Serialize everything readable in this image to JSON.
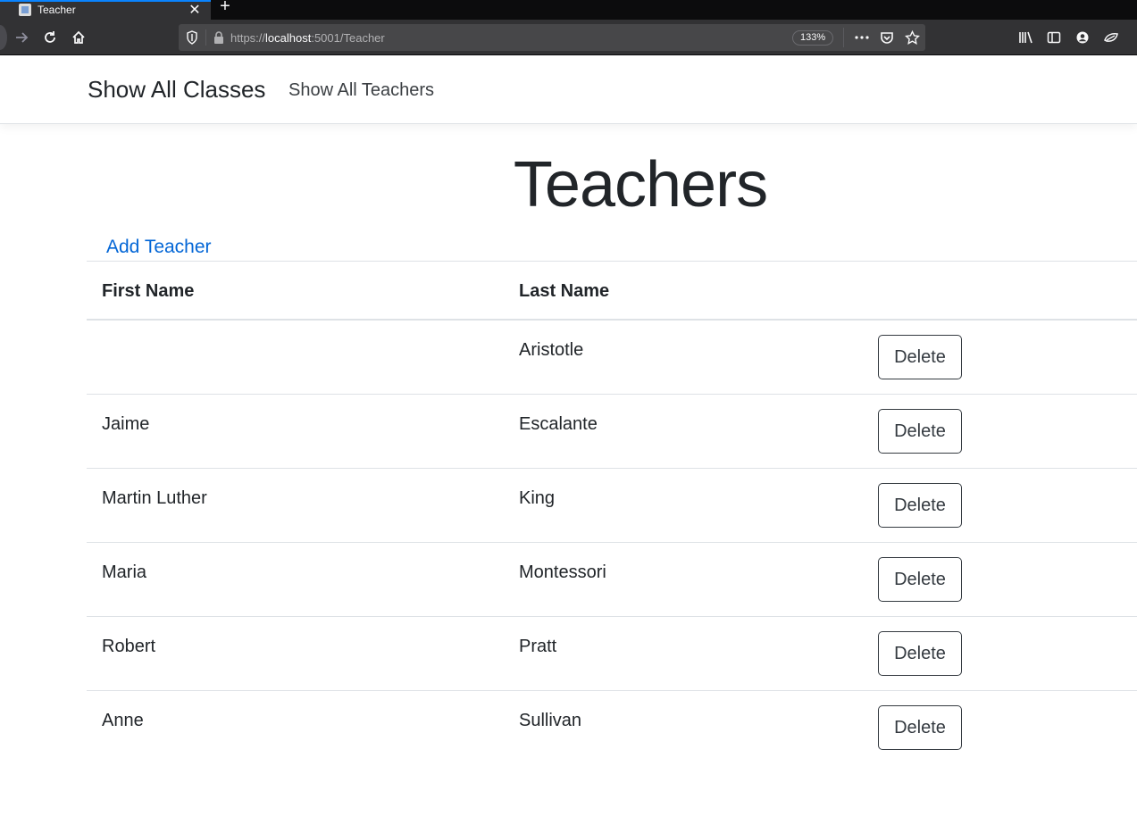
{
  "browser": {
    "tab_title": "Teacher",
    "url_prefix": "https://",
    "url_host": "localhost",
    "url_rest": ":5001/Teacher",
    "zoom": "133%"
  },
  "nav": {
    "brand": "Show All Classes",
    "link": "Show All Teachers"
  },
  "page": {
    "title": "Teachers",
    "add_link": "Add Teacher"
  },
  "table": {
    "headers": [
      "First Name",
      "Last Name"
    ],
    "rows": [
      {
        "first": "",
        "last": "Aristotle",
        "action": "Delete"
      },
      {
        "first": "Jaime",
        "last": "Escalante",
        "action": "Delete"
      },
      {
        "first": "Martin Luther",
        "last": "King",
        "action": "Delete"
      },
      {
        "first": "Maria",
        "last": "Montessori",
        "action": "Delete"
      },
      {
        "first": "Robert",
        "last": "Pratt",
        "action": "Delete"
      },
      {
        "first": "Anne",
        "last": "Sullivan",
        "action": "Delete"
      }
    ]
  }
}
